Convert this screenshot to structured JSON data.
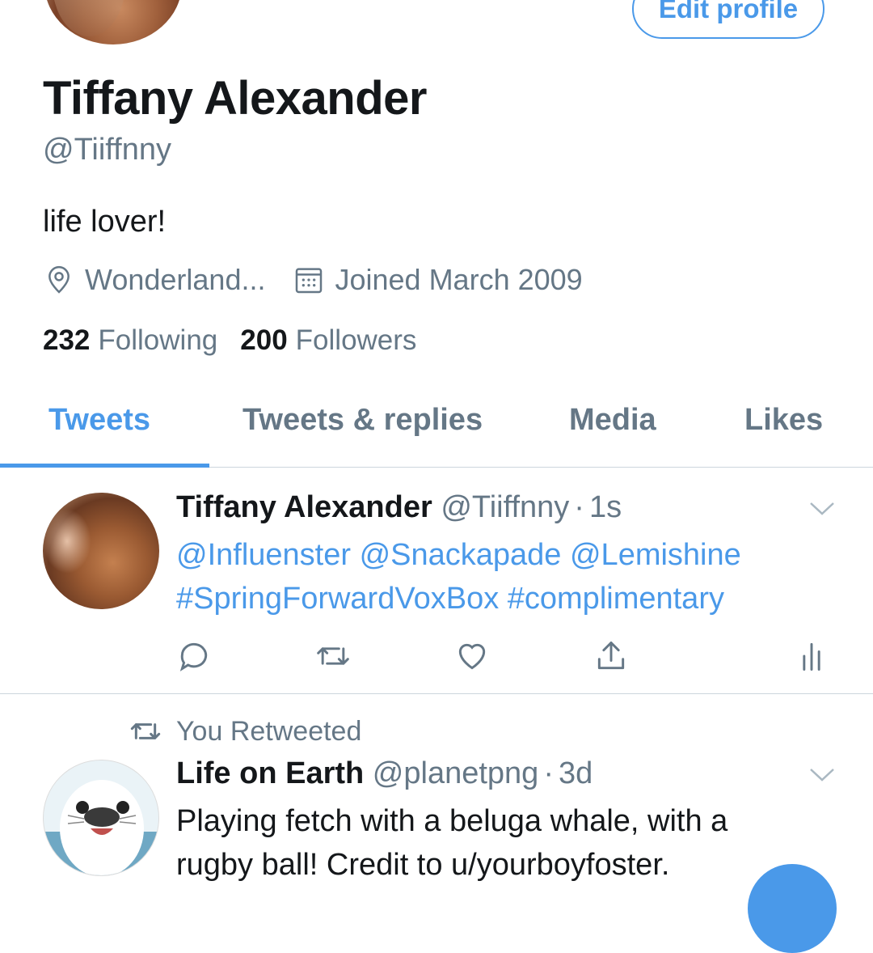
{
  "profile": {
    "edit_profile_label": "Edit profile",
    "display_name": "Tiffany Alexander",
    "handle": "@Tiiffnny",
    "bio": "life lover!",
    "location": "Wonderland...",
    "joined": "Joined March 2009",
    "following_count": "232",
    "following_label": "Following",
    "followers_count": "200",
    "followers_label": "Followers"
  },
  "tabs": [
    {
      "label": "Tweets",
      "active": true
    },
    {
      "label": "Tweets & replies",
      "active": false
    },
    {
      "label": "Media",
      "active": false
    },
    {
      "label": "Likes",
      "active": false
    }
  ],
  "tweets": [
    {
      "author": "Tiffany Alexander",
      "handle": "@Tiiffnny",
      "separator": "·",
      "time": "1s",
      "text_line1": "@Influenster @Snackapade @Lemishine",
      "text_line2": "#SpringForwardVoxBox #complimentary"
    },
    {
      "context": "You Retweeted",
      "author": "Life on Earth",
      "handle": "@planetpng",
      "separator": "·",
      "time": "3d",
      "text_line1": "Playing fetch with a beluga whale, with a",
      "text_line2": "rugby ball! Credit to u/yourboyfoster."
    }
  ],
  "icons": {
    "location": "location-pin-icon",
    "calendar": "calendar-icon",
    "reply": "reply-icon",
    "retweet": "retweet-icon",
    "like": "heart-icon",
    "share": "share-icon",
    "analytics": "analytics-icon",
    "chevron": "chevron-down-icon"
  },
  "colors": {
    "accent": "#4a99e9",
    "text_primary": "#14171a",
    "text_secondary": "#657786",
    "divider": "#ccd6dd"
  }
}
